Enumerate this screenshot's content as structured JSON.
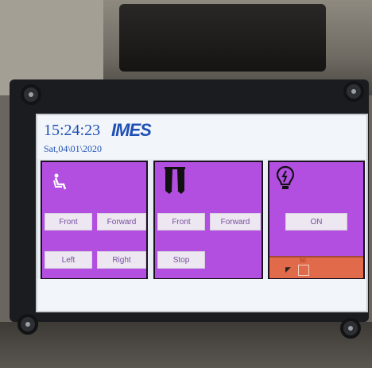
{
  "header": {
    "time": "15:24:23",
    "logo": "IMES",
    "date": "Sat,04\\01\\2020"
  },
  "panel_seat": {
    "icon": "seat-icon",
    "buttons": [
      "Front",
      "Forward",
      "Left",
      "Right"
    ]
  },
  "panel_curtain": {
    "icon": "curtain-icon",
    "buttons": [
      "Front",
      "Forward",
      "Stop"
    ]
  },
  "panel_light": {
    "icon": "lightbulb-icon",
    "on_label": "ON",
    "level_label": "50"
  },
  "colors": {
    "panel": "#b24fe0",
    "accent": "#1f4fb5",
    "status": "#e06a4a"
  }
}
